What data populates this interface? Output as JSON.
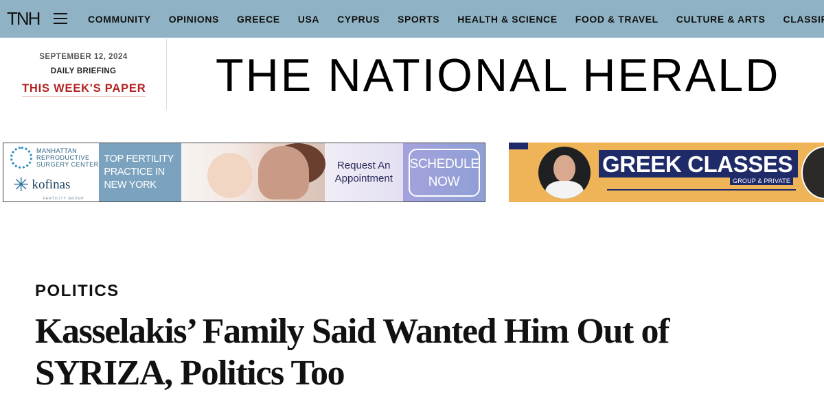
{
  "header": {
    "logo": "TNH",
    "menu_icon": "hamburger-menu-icon",
    "nav": [
      "COMMUNITY",
      "OPINIONS",
      "GREECE",
      "USA",
      "CYPRUS",
      "SPORTS",
      "HEALTH & SCIENCE",
      "FOOD & TRAVEL",
      "CULTURE & ARTS",
      "CLASSIFIEDS"
    ],
    "bg_color": "#8fb3c4"
  },
  "briefing": {
    "date": "SEPTEMBER 12, 2024",
    "daily": "DAILY BRIEFING",
    "paper_link": "THIS WEEK'S PAPER",
    "link_color": "#b2221f"
  },
  "masthead": {
    "title": "THE NATIONAL HERALD"
  },
  "ads": {
    "fertility": {
      "org_name": "MANHATTAN\nREPRODUCTIVE\nSURGERY CENTER",
      "brand": "kofinas",
      "brand_sub": "FERTILITY GROUP",
      "tagline": "TOP FERTILITY PRACTICE IN NEW YORK",
      "request": "Request An Appointment",
      "cta": "SCHEDULE NOW"
    },
    "greek": {
      "title": "GREEK CLASSES",
      "subtitle": "GROUP & PRIVATE",
      "bg_color": "#efb457",
      "accent_color": "#1f2a68"
    }
  },
  "article": {
    "section": "POLITICS",
    "headline": "Kasselakis’ Family Said Wanted Him Out of SYRIZA, Politics Too"
  }
}
